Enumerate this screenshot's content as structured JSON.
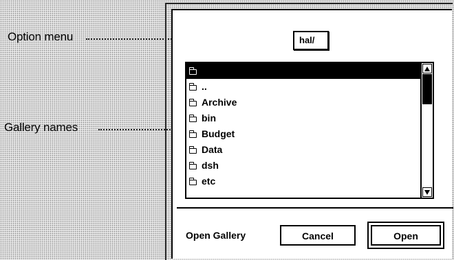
{
  "callouts": {
    "option_menu": "Option menu",
    "gallery_names": "Gallery names"
  },
  "dialog": {
    "option_menu_value": "hal/",
    "list": {
      "items": [
        "",
        "..",
        "Archive",
        "bin",
        "Budget",
        "Data",
        "dsh",
        "etc"
      ],
      "selected_index": 0,
      "item_icon": "folder-icon"
    },
    "footer_label": "Open Gallery",
    "cancel_label": "Cancel",
    "open_label": "Open"
  }
}
